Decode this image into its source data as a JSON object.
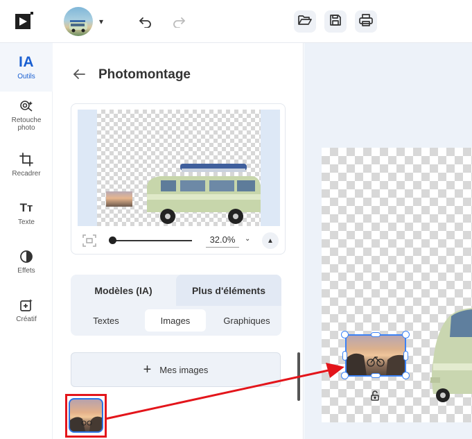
{
  "topbar": {
    "logo_icon": "play-logo-icon",
    "account_icon": "avatar-photo",
    "menu_caret": "▾",
    "undo_icon": "undo-icon",
    "redo_icon": "redo-icon",
    "open_icon": "folder-open-icon",
    "save_icon": "save-icon",
    "print_icon": "print-icon"
  },
  "rail": {
    "items": [
      {
        "label": "Outils",
        "glyph": "IA",
        "active": true
      },
      {
        "label": "Retouche photo",
        "icon": "photo-retouch-icon"
      },
      {
        "label": "Recadrer",
        "icon": "crop-icon"
      },
      {
        "label": "Texte",
        "glyph": "Tт"
      },
      {
        "label": "Effets",
        "icon": "effects-icon"
      },
      {
        "label": "Créatif",
        "icon": "creative-icon"
      }
    ]
  },
  "panel": {
    "title": "Photomontage",
    "zoom": {
      "value": "32.0%",
      "caret": "⌄",
      "collapse": "▲"
    },
    "tabs": [
      {
        "label": "Modèles (IA)",
        "active": false
      },
      {
        "label": "Plus d'éléments",
        "active": true
      }
    ],
    "subtabs": [
      {
        "label": "Textes",
        "active": false
      },
      {
        "label": "Images",
        "active": true
      },
      {
        "label": "Graphiques",
        "active": false
      }
    ],
    "add_button": {
      "plus": "+",
      "label": "Mes images"
    }
  },
  "colors": {
    "accent": "#1a5fd1",
    "selection": "#3b82f6",
    "annotation": "#e3151b"
  }
}
